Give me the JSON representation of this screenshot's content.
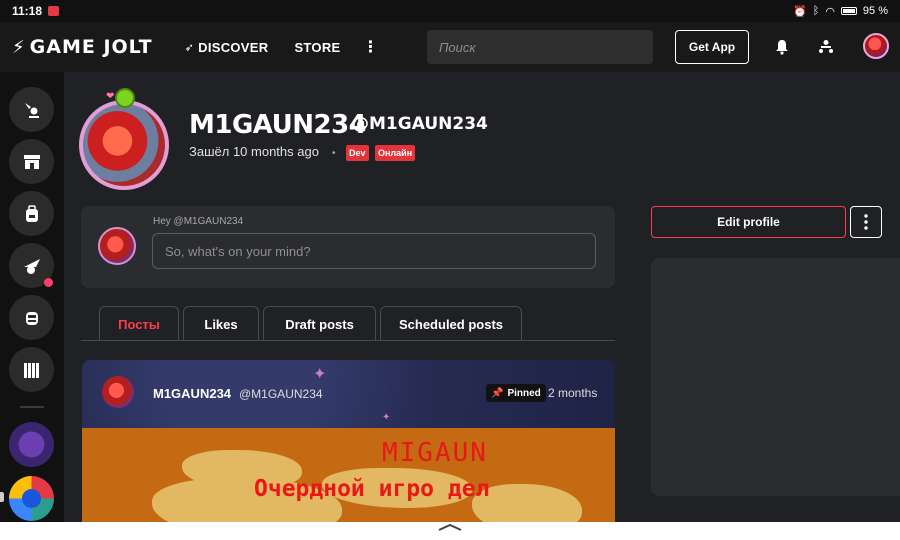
{
  "status_bar": {
    "time": "11:18",
    "battery": "95 %"
  },
  "topbar": {
    "logo": "GAME JOLT",
    "nav": {
      "discover": "DISCOVER",
      "store": "STORE"
    },
    "search_placeholder": "Поиск",
    "get_app": "Get App"
  },
  "profile": {
    "display_name": "M1GAUN234",
    "handle": "@M1GAUN234",
    "last_seen": "Зашёл 10 months ago",
    "badges": [
      "Dev",
      "Онлайн"
    ]
  },
  "post_box": {
    "greeting": "Hey @M1GAUN234",
    "placeholder": "So, what's on your mind?"
  },
  "tabs": [
    "Посты",
    "Likes",
    "Draft posts",
    "Scheduled posts"
  ],
  "feed": {
    "author": "M1GAUN234",
    "handle": "@M1GAUN234",
    "pinned": "Pinned",
    "time": "2 months",
    "image_title": "MIGAUN",
    "image_subtitle": "Очердной игро дел"
  },
  "actions": {
    "edit_profile": "Edit profile"
  },
  "colors": {
    "accent": "#ff3c4c",
    "background": "#202124",
    "card": "#2b2c30"
  }
}
